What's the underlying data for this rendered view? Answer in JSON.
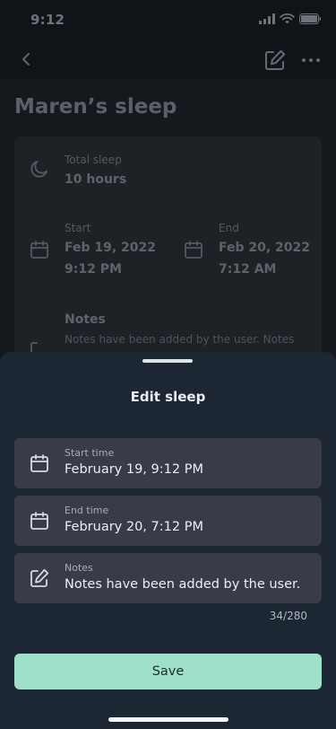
{
  "status_bar": {
    "time": "9:12"
  },
  "header": {
    "back_icon": "chevron-left-icon",
    "edit_icon": "edit-icon",
    "more_icon": "more-horizontal-icon"
  },
  "page": {
    "title": "Maren’s sleep"
  },
  "details": {
    "total_sleep": {
      "label": "Total sleep",
      "value": "10 hours",
      "icon": "moon-icon"
    },
    "start": {
      "label": "Start",
      "date": "Feb 19, 2022",
      "time": "9:12 PM",
      "icon": "calendar-icon"
    },
    "end": {
      "label": "End",
      "date": "Feb 20, 2022",
      "time": "7:12 AM",
      "icon": "calendar-icon"
    },
    "notes": {
      "label": "Notes",
      "value": "Notes have been added by the user. Notes"
    }
  },
  "sheet": {
    "title": "Edit sleep",
    "fields": [
      {
        "label": "Start time",
        "value": "February 19, 9:12 PM",
        "icon": "calendar-icon"
      },
      {
        "label": "End time",
        "value": "February 20, 7:12 PM",
        "icon": "calendar-icon"
      },
      {
        "label": "Notes",
        "value": "Notes have been added by the user.",
        "icon": "edit-icon"
      }
    ],
    "counter": "34/280",
    "save_label": "Save"
  },
  "colors": {
    "accent": "#9ee0c8",
    "sheet_bg": "#1c2733",
    "field_bg": "#3a3b48"
  }
}
